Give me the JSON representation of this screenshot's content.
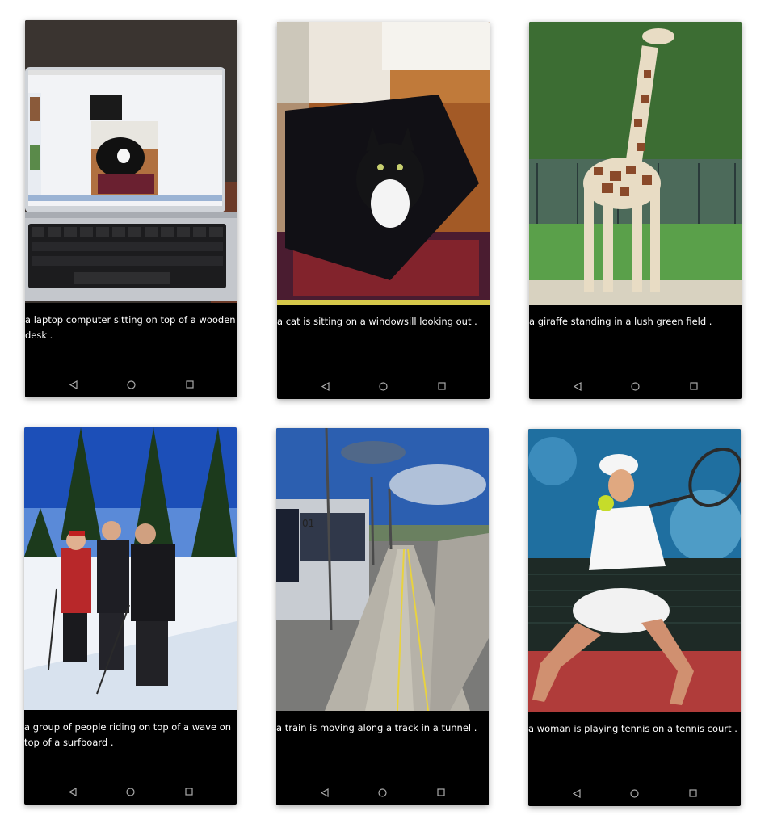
{
  "screens": [
    {
      "caption": "a laptop computer sitting on top of a wooden desk .",
      "photo_icon": "laptop-photo"
    },
    {
      "caption": "a cat is sitting on a windowsill looking out .",
      "photo_icon": "cat-photo"
    },
    {
      "caption": "a giraffe standing in a lush green field .",
      "photo_icon": "giraffe-photo"
    },
    {
      "caption": "a group of people riding on top of a wave on top of a surfboard .",
      "photo_icon": "skiers-photo"
    },
    {
      "caption": "a train is moving along a track in a tunnel .",
      "photo_icon": "train-photo"
    },
    {
      "caption": "a woman is playing tennis on a tennis court .",
      "photo_icon": "tennis-photo"
    }
  ],
  "navbar": {
    "back_icon": "back-triangle-icon",
    "home_icon": "home-circle-icon",
    "recents_icon": "recents-square-icon"
  }
}
